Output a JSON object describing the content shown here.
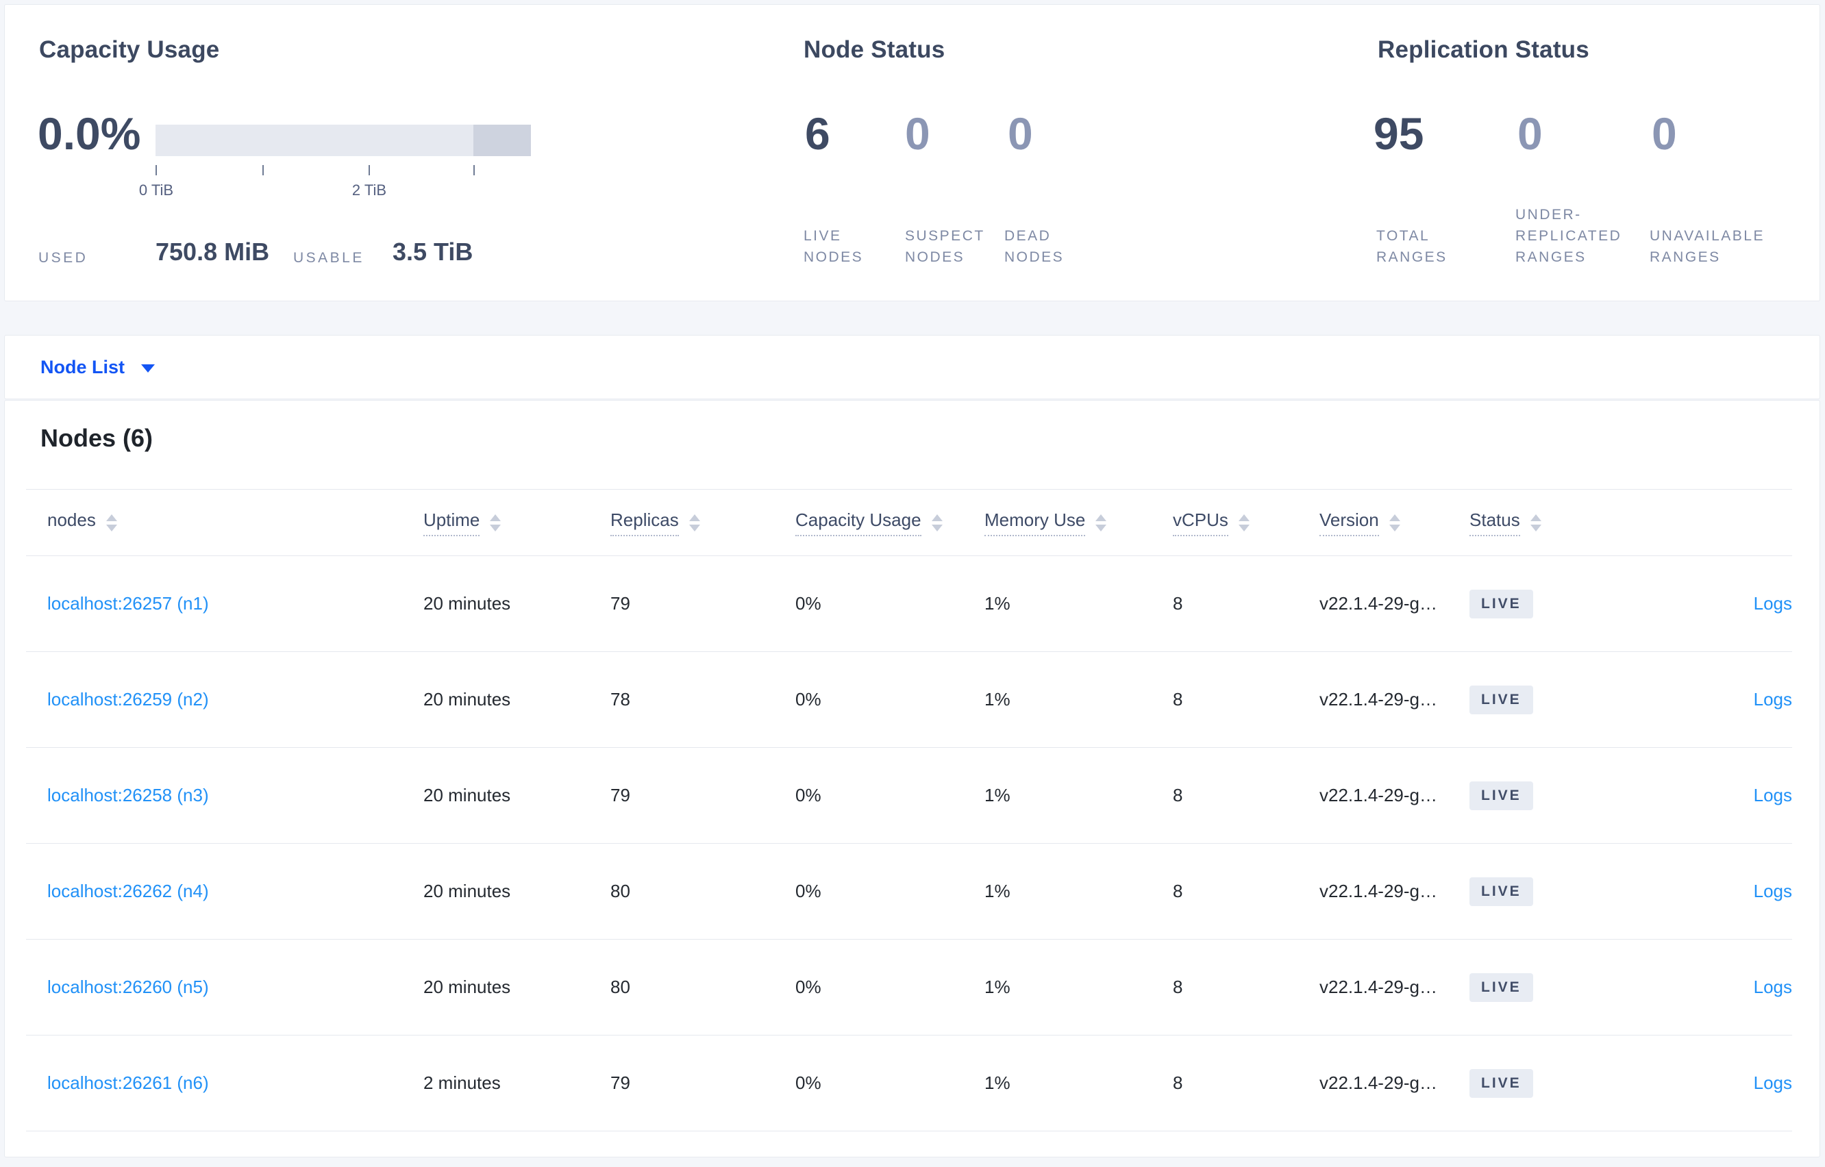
{
  "colors": {
    "page_background": "#f4f6fa",
    "primary_blue": "#1355f4",
    "link_blue": "#2191f7",
    "stat_dark": "#3e4a63",
    "stat_muted": "#8b96b4",
    "gauge_track": "#e6e9f0",
    "gauge_segment": "#ced3df",
    "badge_background": "#e8ecf3"
  },
  "capacity": {
    "title": "Capacity Usage",
    "percent": "0.0%",
    "gauge": {
      "tick_label_0": "0 TiB",
      "tick_label_2": "2 TiB",
      "used_fraction": 0.0
    },
    "used_label": "USED",
    "used_value": "750.8 MiB",
    "usable_label": "USABLE",
    "usable_value": "3.5 TiB"
  },
  "node_status": {
    "title": "Node Status",
    "stats": [
      {
        "value": "6",
        "label_lines": [
          "LIVE",
          "NODES"
        ]
      },
      {
        "value": "0",
        "label_lines": [
          "SUSPECT",
          "NODES"
        ]
      },
      {
        "value": "0",
        "label_lines": [
          "DEAD",
          "NODES"
        ]
      }
    ]
  },
  "replication_status": {
    "title": "Replication Status",
    "stats": [
      {
        "value": "95",
        "label_lines": [
          "TOTAL",
          "RANGES"
        ]
      },
      {
        "value": "0",
        "label_lines": [
          "UNDER-",
          "REPLICATED",
          "RANGES"
        ]
      },
      {
        "value": "0",
        "label_lines": [
          "UNAVAILABLE",
          "RANGES"
        ]
      }
    ]
  },
  "node_list_bar": {
    "label": "Node List"
  },
  "nodes_table": {
    "title": "Nodes (6)",
    "columns": [
      "nodes",
      "Uptime",
      "Replicas",
      "Capacity Usage",
      "Memory Use",
      "vCPUs",
      "Version",
      "Status"
    ],
    "logs_label": "Logs",
    "rows": [
      {
        "name": "localhost:26257 (n1)",
        "uptime": "20 minutes",
        "replicas": "79",
        "capacity_usage": "0%",
        "memory_use": "1%",
        "vcpus": "8",
        "version": "v22.1.4-29-g…",
        "status": "LIVE"
      },
      {
        "name": "localhost:26259 (n2)",
        "uptime": "20 minutes",
        "replicas": "78",
        "capacity_usage": "0%",
        "memory_use": "1%",
        "vcpus": "8",
        "version": "v22.1.4-29-g…",
        "status": "LIVE"
      },
      {
        "name": "localhost:26258 (n3)",
        "uptime": "20 minutes",
        "replicas": "79",
        "capacity_usage": "0%",
        "memory_use": "1%",
        "vcpus": "8",
        "version": "v22.1.4-29-g…",
        "status": "LIVE"
      },
      {
        "name": "localhost:26262 (n4)",
        "uptime": "20 minutes",
        "replicas": "80",
        "capacity_usage": "0%",
        "memory_use": "1%",
        "vcpus": "8",
        "version": "v22.1.4-29-g…",
        "status": "LIVE"
      },
      {
        "name": "localhost:26260 (n5)",
        "uptime": "20 minutes",
        "replicas": "80",
        "capacity_usage": "0%",
        "memory_use": "1%",
        "vcpus": "8",
        "version": "v22.1.4-29-g…",
        "status": "LIVE"
      },
      {
        "name": "localhost:26261 (n6)",
        "uptime": "2 minutes",
        "replicas": "79",
        "capacity_usage": "0%",
        "memory_use": "1%",
        "vcpus": "8",
        "version": "v22.1.4-29-g…",
        "status": "LIVE"
      }
    ]
  }
}
